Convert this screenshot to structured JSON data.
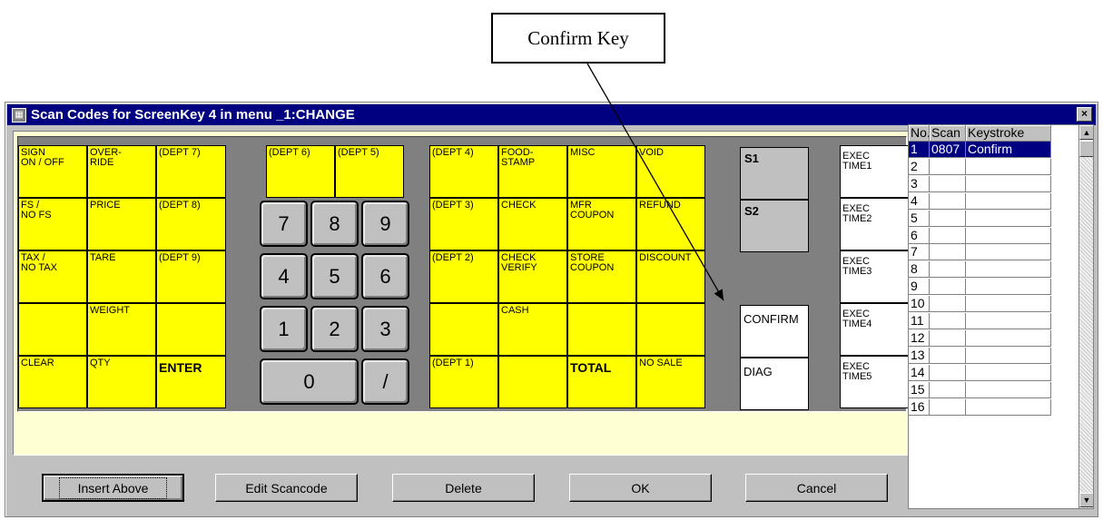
{
  "callout": {
    "label": "Confirm Key"
  },
  "window": {
    "title": "Scan Codes for ScreenKey 4 in menu _1:CHANGE",
    "close_glyph": "×",
    "icon_name": "grid-app-icon"
  },
  "keys": {
    "sign_on_off": "SIGN\nON / OFF",
    "override": "OVER-\nRIDE",
    "dept7": "(DEPT 7)",
    "fs_no_fs": "FS /\nNO FS",
    "price": "PRICE",
    "dept8": "(DEPT 8)",
    "tax_no_tax": "TAX /\nNO TAX",
    "tare": "TARE",
    "dept9": "(DEPT 9)",
    "weight": "WEIGHT",
    "clear": "CLEAR",
    "qty": "QTY",
    "enter": "ENTER",
    "dept6": "(DEPT 6)",
    "dept5": "(DEPT 5)",
    "dept4": "(DEPT 4)",
    "food_stamp": "FOOD-\nSTAMP",
    "misc": "MISC",
    "void": "VOID",
    "dept3": "(DEPT 3)",
    "check": "CHECK",
    "mfr_coupon": "MFR\nCOUPON",
    "refund": "REFUND",
    "dept2": "(DEPT 2)",
    "check_verify": "CHECK\nVERIFY",
    "store_coupon": "STORE\nCOUPON",
    "discount": "DISCOUNT",
    "cash": "CASH",
    "dept1": "(DEPT 1)",
    "total": "TOTAL",
    "no_sale": "NO SALE",
    "s1": "S1",
    "s2": "S2",
    "confirm": "CONFIRM",
    "diag": "DIAG",
    "exec1": "EXEC\nTIME1",
    "exec2": "EXEC\nTIME2",
    "exec3": "EXEC\nTIME3",
    "exec4": "EXEC\nTIME4",
    "exec5": "EXEC\nTIME5"
  },
  "numpad": {
    "k7": "7",
    "k8": "8",
    "k9": "9",
    "k4": "4",
    "k5": "5",
    "k6": "6",
    "k1": "1",
    "k2": "2",
    "k3": "3",
    "k0": "0",
    "slash": "/"
  },
  "buttons": {
    "insert_above": "Insert Above",
    "edit_scancode": "Edit Scancode",
    "delete": "Delete",
    "ok": "OK",
    "cancel": "Cancel"
  },
  "grid": {
    "headers": [
      "No.",
      "Scan",
      "Keystroke"
    ],
    "rows": [
      {
        "no": "1",
        "scan": "0807",
        "keystroke": "Confirm"
      },
      {
        "no": "2",
        "scan": "",
        "keystroke": ""
      },
      {
        "no": "3",
        "scan": "",
        "keystroke": ""
      },
      {
        "no": "4",
        "scan": "",
        "keystroke": ""
      },
      {
        "no": "5",
        "scan": "",
        "keystroke": ""
      },
      {
        "no": "6",
        "scan": "",
        "keystroke": ""
      },
      {
        "no": "7",
        "scan": "",
        "keystroke": ""
      },
      {
        "no": "8",
        "scan": "",
        "keystroke": ""
      },
      {
        "no": "9",
        "scan": "",
        "keystroke": ""
      },
      {
        "no": "10",
        "scan": "",
        "keystroke": ""
      },
      {
        "no": "11",
        "scan": "",
        "keystroke": ""
      },
      {
        "no": "12",
        "scan": "",
        "keystroke": ""
      },
      {
        "no": "13",
        "scan": "",
        "keystroke": ""
      },
      {
        "no": "14",
        "scan": "",
        "keystroke": ""
      },
      {
        "no": "15",
        "scan": "",
        "keystroke": ""
      },
      {
        "no": "16",
        "scan": "",
        "keystroke": ""
      }
    ],
    "scroll_up_glyph": "▲",
    "scroll_down_glyph": "▼"
  },
  "colors": {
    "key_yellow": "#ffff00",
    "title_blue": "#000080",
    "panel_cream": "#ffffd4"
  }
}
